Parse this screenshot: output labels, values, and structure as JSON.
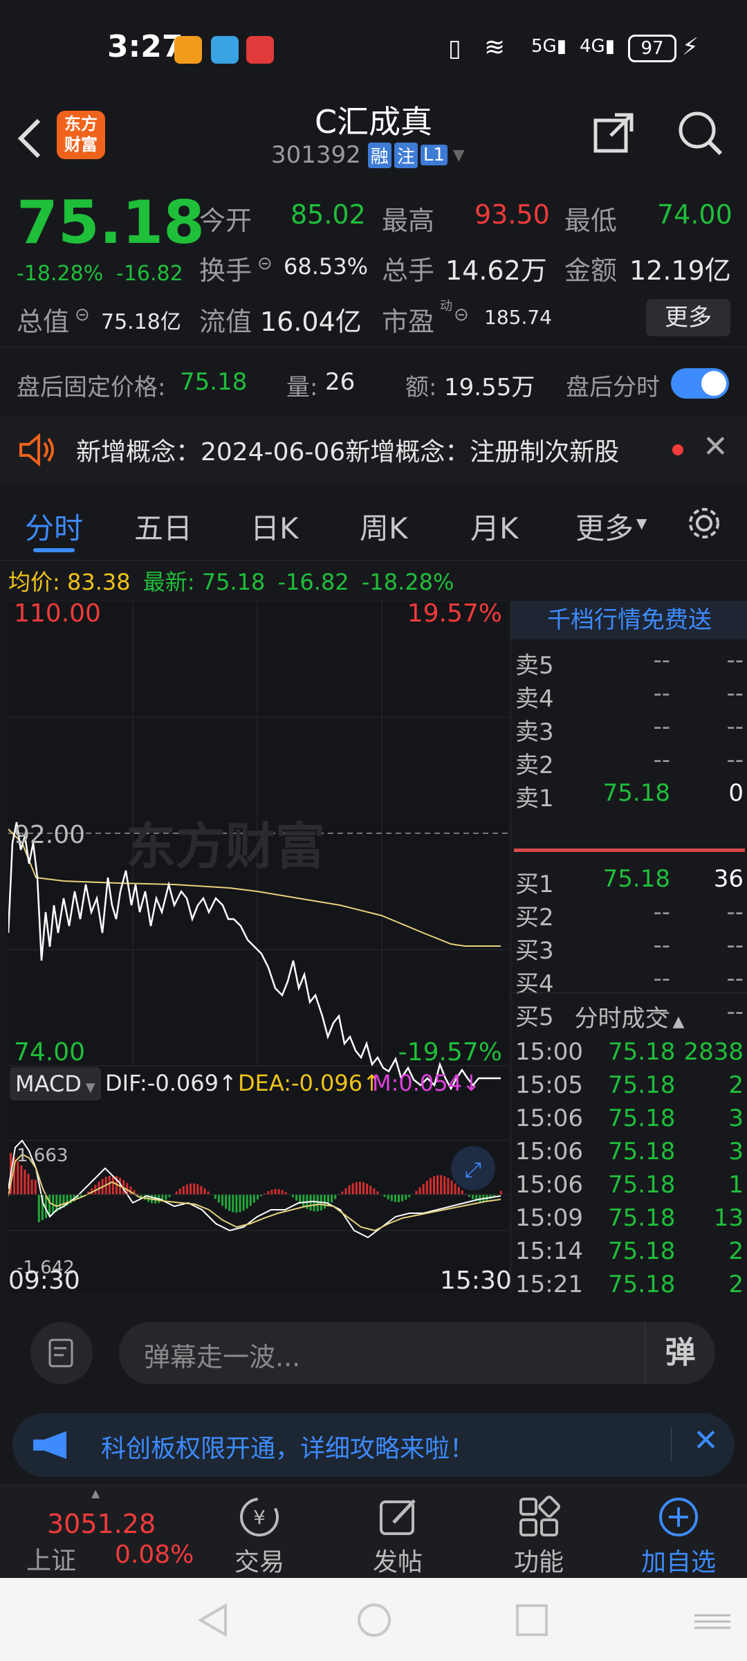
{
  "status_bar": {
    "time": "3:27",
    "battery": "97"
  },
  "header": {
    "logo_line1": "东方",
    "logo_line2": "财富",
    "stock_name": "C汇成真",
    "stock_code": "301392",
    "badges": [
      "融",
      "注",
      "L1"
    ]
  },
  "quote": {
    "price": "75.18",
    "change_pct": "-18.28%",
    "change": "-16.82",
    "open_label": "今开",
    "open": "85.02",
    "high_label": "最高",
    "high": "93.50",
    "low_label": "最低",
    "low": "74.00",
    "turnover_label": "换手",
    "turnover": "68.53%",
    "volume_label": "总手",
    "volume": "14.62万",
    "amount_label": "金额",
    "amount": "12.19亿",
    "mktcap_label": "总值",
    "mktcap": "75.18亿",
    "float_label": "流值",
    "float": "16.04亿",
    "pe_label": "市盈",
    "pe_sup": "动",
    "pe": "185.74",
    "more_button": "更多"
  },
  "after_hours": {
    "price_label": "盘后固定价格:",
    "price": "75.18",
    "vol_label": "量:",
    "vol": "26",
    "amt_label": "额:",
    "amt": "19.55万",
    "toggle_label": "盘后分时"
  },
  "notice": {
    "text": "新增概念：2024-06-06新增概念：注册制次新股"
  },
  "tabs": [
    "分时",
    "五日",
    "日K",
    "周K",
    "月K",
    "更多"
  ],
  "info_line": {
    "avg_label": "均价:",
    "avg": "83.38",
    "last_label": "最新:",
    "last": "75.18",
    "chg": "-16.82",
    "pct": "-18.28%"
  },
  "chart_labels": {
    "top_price": "110.00",
    "top_pct": "19.57%",
    "mid_price": "92.00",
    "bottom_price": "74.00",
    "bottom_pct": "-19.57%",
    "watermark": "东方财富",
    "time_start": "09:30",
    "time_end": "15:30"
  },
  "macd": {
    "label": "MACD",
    "dif": "DIF:-0.069↑",
    "dea": "DEA:-0.096↑",
    "m": "M:0.054↓",
    "max": "1.663",
    "min": "-1.642"
  },
  "orderbook": {
    "banner": "千档行情免费送",
    "asks": [
      {
        "label": "卖5",
        "price": "--",
        "vol": "--"
      },
      {
        "label": "卖4",
        "price": "--",
        "vol": "--"
      },
      {
        "label": "卖3",
        "price": "--",
        "vol": "--"
      },
      {
        "label": "卖2",
        "price": "--",
        "vol": "--"
      },
      {
        "label": "卖1",
        "price": "75.18",
        "vol": "0"
      }
    ],
    "bids": [
      {
        "label": "买1",
        "price": "75.18",
        "vol": "36"
      },
      {
        "label": "买2",
        "price": "--",
        "vol": "--"
      },
      {
        "label": "买3",
        "price": "--",
        "vol": "--"
      },
      {
        "label": "买4",
        "price": "--",
        "vol": "--"
      },
      {
        "label": "买5",
        "price": "--",
        "vol": "--"
      }
    ],
    "trades_title": "分时成交",
    "trades": [
      {
        "time": "15:00",
        "price": "75.18",
        "vol": "2838"
      },
      {
        "time": "15:05",
        "price": "75.18",
        "vol": "2"
      },
      {
        "time": "15:06",
        "price": "75.18",
        "vol": "3"
      },
      {
        "time": "15:06",
        "price": "75.18",
        "vol": "3"
      },
      {
        "time": "15:06",
        "price": "75.18",
        "vol": "1"
      },
      {
        "time": "15:09",
        "price": "75.18",
        "vol": "13"
      },
      {
        "time": "15:14",
        "price": "75.18",
        "vol": "2"
      },
      {
        "time": "15:21",
        "price": "75.18",
        "vol": "2"
      }
    ]
  },
  "danmu": {
    "placeholder": "弹幕走一波...",
    "button": "弹"
  },
  "promo": {
    "text": "科创板权限开通，详细攻略来啦！"
  },
  "bottom_nav": {
    "index_value": "3051.28",
    "index_name": "上证",
    "index_pct": "0.08%",
    "items": [
      "交易",
      "发帖",
      "功能",
      "加自选"
    ]
  },
  "colors": {
    "up": "#f23b3b",
    "down": "#1fbf3a",
    "accent": "#3d8bfd",
    "avg_line": "#e8d27a"
  }
}
